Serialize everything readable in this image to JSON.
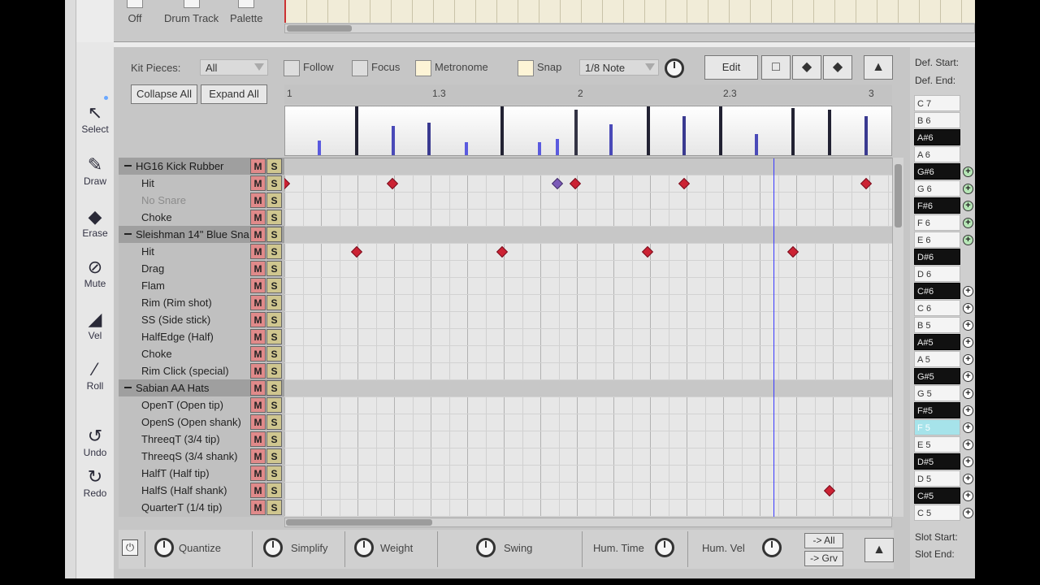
{
  "top": {
    "off": "Off",
    "drum_track": "Drum Track",
    "palette": "Palette"
  },
  "tools": [
    "Select",
    "Draw",
    "Erase",
    "Mute",
    "Vel",
    "Roll",
    "Undo",
    "Redo"
  ],
  "header": {
    "kit_pieces_label": "Kit Pieces:",
    "kit_pieces_value": "All",
    "follow": "Follow",
    "focus": "Focus",
    "metronome": "Metronome",
    "snap": "Snap",
    "snap_value": "1/8 Note",
    "edit": "Edit",
    "collapse_all": "Collapse All",
    "expand_all": "Expand All",
    "btn_select_glyph": "□",
    "btn_prev_glyph": "◆",
    "btn_next_glyph": "◆",
    "btn_up_glyph": "▲"
  },
  "ruler": [
    "1",
    "1.3",
    "2",
    "2.3",
    "3"
  ],
  "pieces": [
    {
      "label": "HG16 Kick Rubber",
      "group": true
    },
    {
      "label": "Hit"
    },
    {
      "label": "No Snare",
      "disabled": true
    },
    {
      "label": "Choke"
    },
    {
      "label": "Sleishman 14\" Blue Sna",
      "group": true
    },
    {
      "label": "Hit"
    },
    {
      "label": "Drag"
    },
    {
      "label": "Flam"
    },
    {
      "label": "Rim (Rim shot)"
    },
    {
      "label": "SS (Side stick)"
    },
    {
      "label": "HalfEdge (Half)"
    },
    {
      "label": "Choke"
    },
    {
      "label": "Rim Click (special)"
    },
    {
      "label": "Sabian AA Hats",
      "group": true
    },
    {
      "label": "OpenT (Open tip)"
    },
    {
      "label": "OpenS (Open shank)"
    },
    {
      "label": "ThreeqT (3/4 tip)"
    },
    {
      "label": "ThreeqS (3/4 shank)"
    },
    {
      "label": "HalfT (Half tip)"
    },
    {
      "label": "HalfS (Half shank)"
    },
    {
      "label": "QuarterT (1/4 tip)"
    }
  ],
  "mute_label": "M",
  "solo_label": "S",
  "bottom": {
    "quantize": "Quantize",
    "simplify": "Simplify",
    "weight": "Weight",
    "swing": "Swing",
    "hum_time": "Hum. Time",
    "hum_vel": "Hum. Vel",
    "to_all": "-> All",
    "to_grv": "-> Grv"
  },
  "right": {
    "def_start": "Def. Start:",
    "def_end": "Def. End:",
    "slot_start": "Slot Start:",
    "slot_end": "Slot End:",
    "keys": [
      "C 7",
      "B 6",
      "A#6",
      "A 6",
      "G#6",
      "G 6",
      "F#6",
      "F 6",
      "E 6",
      "D#6",
      "D 6",
      "C#6",
      "C 6",
      "B 5",
      "A#5",
      "A 5",
      "G#5",
      "G 5",
      "F#5",
      "F 5",
      "E 5",
      "D#5",
      "D 5",
      "C#5",
      "C 5"
    ]
  },
  "colors": {
    "note": "#cc2233",
    "note_selected": "#7b5ab8",
    "playhead": "#3a3aff",
    "mute": "#e08a8a",
    "solo": "#cfc68f"
  },
  "icons": [
    "arrow-pointer-icon",
    "pencil-icon",
    "eraser-icon",
    "mute-icon",
    "velocity-icon",
    "roll-icon",
    "undo-icon",
    "redo-icon",
    "power-icon"
  ]
}
